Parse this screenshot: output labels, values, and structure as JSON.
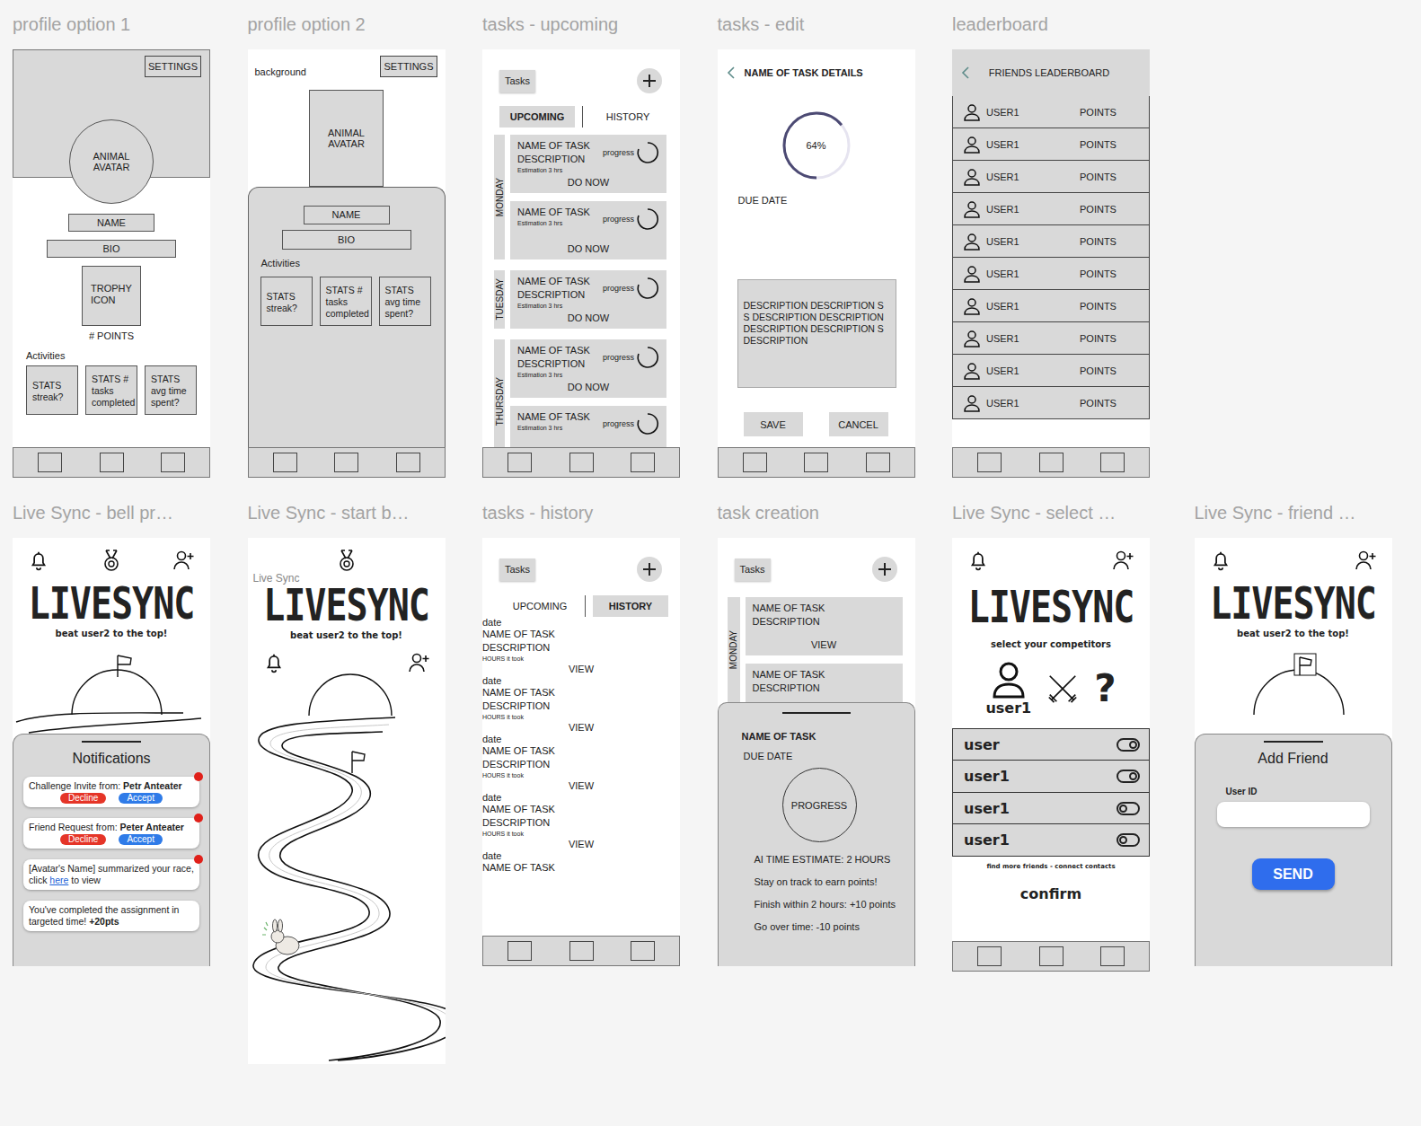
{
  "profile1": {
    "label": "profile option 1",
    "settings": "SETTINGS",
    "avatar": "ANIMAL AVATAR",
    "name": "NAME",
    "bio": "BIO",
    "trophy": "TROPHY ICON",
    "points": "# POINTS",
    "activities": "Activities",
    "stats": [
      "STATS streak?",
      "STATS # tasks completed",
      "STATS avg time spent?"
    ]
  },
  "profile2": {
    "label": "profile option 2",
    "background": "background",
    "settings": "SETTINGS",
    "avatar": "ANIMAL AVATAR",
    "name": "NAME",
    "bio": "BIO",
    "activities": "Activities",
    "stats": [
      "STATS streak?",
      "STATS # tasks completed",
      "STATS avg time spent?"
    ]
  },
  "tasksUpcoming": {
    "label": "tasks - upcoming",
    "title": "Tasks",
    "tabs": [
      {
        "label": "UPCOMING",
        "selected": true
      },
      {
        "label": "HISTORY",
        "selected": false
      }
    ],
    "days": [
      {
        "day": "MONDAY",
        "tasks": [
          {
            "name": "NAME OF TASK",
            "description": "DESCRIPTION",
            "estimate": "Estimation 3 hrs",
            "progress": "progress",
            "action": "DO NOW"
          },
          {
            "name": "NAME OF TASK",
            "estimate": "Estimation 3 hrs",
            "progress": "progress",
            "action": "DO NOW"
          }
        ]
      },
      {
        "day": "TUESDAY",
        "tasks": [
          {
            "name": "NAME OF TASK",
            "description": "DESCRIPTION",
            "estimate": "Estimation 3 hrs",
            "progress": "progress",
            "action": "DO NOW"
          }
        ]
      },
      {
        "day": "THURSDAY",
        "tasks": [
          {
            "name": "NAME OF TASK",
            "description": "DESCRIPTION",
            "estimate": "Estimation 3 hrs",
            "progress": "progress",
            "action": "DO NOW"
          },
          {
            "name": "NAME OF TASK",
            "estimate": "Estimation 3 hrs",
            "progress": "progress"
          }
        ]
      }
    ]
  },
  "tasksEdit": {
    "label": "tasks - edit",
    "title": "NAME OF TASK DETAILS",
    "progress": "64%",
    "level": 0.64,
    "dueDate": "DUE DATE",
    "description": "DESCRIPTION DESCRIPTION S S DESCRIPTION DESCRIPTION DESCRIPTION DESCRIPTION S DESCRIPTION",
    "buttons": [
      "SAVE",
      "CANCEL"
    ]
  },
  "leaderboard": {
    "label": "leaderboard",
    "title": "FRIENDS LEADERBOARD",
    "rows": [
      {
        "user": "USER1",
        "points": "POINTS"
      },
      {
        "user": "USER1",
        "points": "POINTS"
      },
      {
        "user": "USER1",
        "points": "POINTS"
      },
      {
        "user": "USER1",
        "points": "POINTS"
      },
      {
        "user": "USER1",
        "points": "POINTS"
      },
      {
        "user": "USER1",
        "points": "POINTS"
      },
      {
        "user": "USER1",
        "points": "POINTS"
      },
      {
        "user": "USER1",
        "points": "POINTS"
      },
      {
        "user": "USER1",
        "points": "POINTS"
      },
      {
        "user": "USER1",
        "points": "POINTS"
      }
    ]
  },
  "liveSyncBell": {
    "label": "Live Sync - bell pr…",
    "logo": "LIVESYNC",
    "subtitle": "beat user2 to the top!",
    "sheetTitle": "Notifications",
    "notifications": [
      {
        "kind": "request",
        "text": "Challenge Invite from:",
        "from": "Petr Anteater",
        "actions": [
          "Decline",
          "Accept"
        ],
        "unread": true
      },
      {
        "kind": "request",
        "text": "Friend Request from:",
        "from": "Peter Anteater",
        "actions": [
          "Decline",
          "Accept"
        ],
        "unread": true
      },
      {
        "kind": "link",
        "before": "[Avatar's Name] summarized your race, click",
        "link": "here",
        "after": "to view",
        "unread": true
      },
      {
        "kind": "points",
        "text": "You've completed the assignment in targeted time!",
        "points": "+20pts",
        "unread": false
      }
    ]
  },
  "liveSyncStart": {
    "label": "Live Sync - start b…",
    "ghost": "Live Sync",
    "logo": "LIVESYNC",
    "subtitle": "beat user2 to the top!"
  },
  "tasksHistory": {
    "label": "tasks - history",
    "title": "Tasks",
    "tabs": [
      {
        "label": "UPCOMING",
        "selected": false
      },
      {
        "label": "HISTORY",
        "selected": true
      }
    ],
    "items": [
      {
        "name": "NAME OF TASK",
        "description": "DESCRIPTION",
        "hours": "HOURS it took",
        "date": "date",
        "action": "VIEW"
      },
      {
        "name": "NAME OF TASK",
        "description": "DESCRIPTION",
        "hours": "HOURS it took",
        "date": "date",
        "action": "VIEW"
      },
      {
        "name": "NAME OF TASK",
        "description": "DESCRIPTION",
        "hours": "HOURS it took",
        "date": "date",
        "action": "VIEW"
      },
      {
        "name": "NAME OF TASK",
        "description": "DESCRIPTION",
        "hours": "HOURS it took",
        "date": "date",
        "action": "VIEW"
      },
      {
        "name": "NAME OF TASK",
        "date": "date"
      }
    ]
  },
  "taskCreation": {
    "label": "task creation",
    "title": "Tasks",
    "day": "MONDAY",
    "tasks": [
      {
        "name": "NAME OF TASK",
        "description": "DESCRIPTION",
        "action": "VIEW"
      },
      {
        "name": "NAME OF TASK",
        "description": "DESCRIPTION"
      }
    ],
    "sheet": {
      "name": "NAME OF TASK",
      "due": "DUE DATE",
      "progress": "PROGRESS",
      "estimate": "AI TIME ESTIMATE: 2 HOURS",
      "lines": [
        "Stay on track to earn points!",
        "Finish within 2 hours: +10 points",
        "Go over time: -10 points"
      ]
    }
  },
  "liveSyncSelect": {
    "label": "Live Sync - select …",
    "logo": "LIVESYNC",
    "subtitle": "select your competitors",
    "me": "user1",
    "mystery": "?",
    "users": [
      {
        "name": "user",
        "on": true
      },
      {
        "name": "user1",
        "on": true
      },
      {
        "name": "user1",
        "on": false
      },
      {
        "name": "user1",
        "on": false
      }
    ],
    "findMore": "find more friends - connect contacts",
    "confirm": "confirm"
  },
  "liveSyncFriend": {
    "label": "Live Sync - friend …",
    "logo": "LIVESYNC",
    "subtitle": "beat user2 to the top!",
    "sheetTitle": "Add Friend",
    "fieldLabel": "User ID",
    "send": "SEND"
  }
}
